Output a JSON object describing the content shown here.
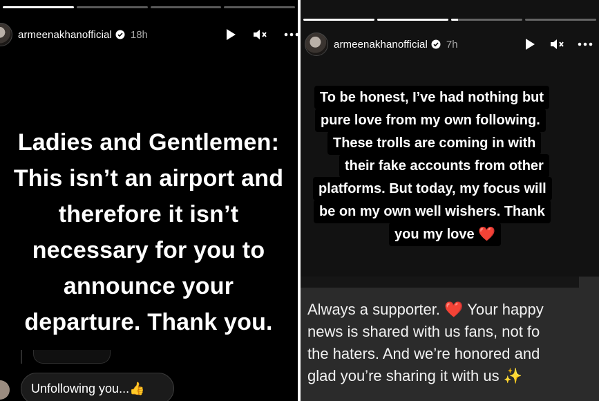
{
  "left_story": {
    "username": "armeenakhanofficial",
    "time": "18h",
    "progress": [
      1,
      0,
      0,
      0
    ],
    "message_lines": [
      "Ladies and Gentlemen:",
      "This isn’t an airport and",
      "therefore it isn’t",
      "necessary for you to",
      "announce your",
      "departure.  Thank you."
    ],
    "reply": "Unfollowing you...👍"
  },
  "right_story": {
    "username": "armeenakhanofficial",
    "time": "7h",
    "progress": [
      1,
      1,
      0.1,
      0
    ],
    "quote_lines": [
      "To be honest, I’ve had nothing but",
      "pure love from my own following.",
      "These trolls are coming in with",
      "their fake accounts from other",
      "platforms. But today, my focus will",
      "be on my own well wishers. Thank",
      "you my love ❤️"
    ],
    "fan_lines": [
      "Always a supporter. ❤️  Your happy",
      "news is shared with us fans, not fo",
      "the haters. And we’re honored and",
      "glad you’re sharing it with us ✨"
    ]
  },
  "icons": {
    "play": "play-icon",
    "mute": "mute-icon",
    "more": "more-icon",
    "verified": "verified-icon"
  },
  "colors": {
    "background_dark": "#000000",
    "background_right": "#121212",
    "text": "#ffffff",
    "muted_text": "#a8a8a8",
    "fan_card": "#2b2b2b",
    "heart": "#e0245e"
  }
}
